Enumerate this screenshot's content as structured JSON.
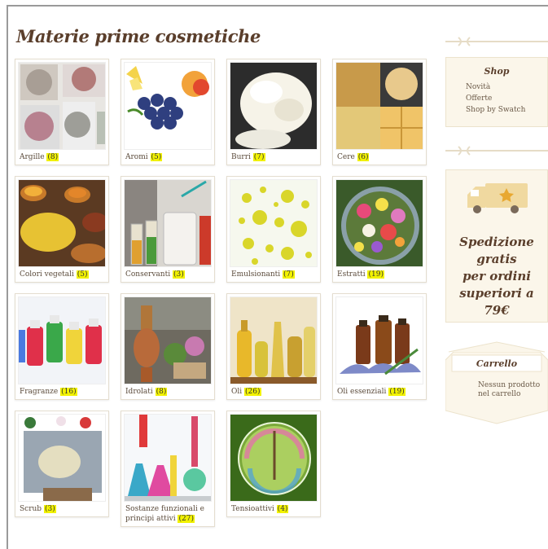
{
  "page": {
    "title": "Materie prime cosmetiche"
  },
  "categories": [
    {
      "name": "Argille",
      "count": "8"
    },
    {
      "name": "Aromi",
      "count": "5"
    },
    {
      "name": "Burri",
      "count": "7"
    },
    {
      "name": "Cere",
      "count": "6"
    },
    {
      "name": "Colori vegetali",
      "count": "5"
    },
    {
      "name": "Conservanti",
      "count": "3"
    },
    {
      "name": "Emulsionanti",
      "count": "7"
    },
    {
      "name": "Estratti",
      "count": "19"
    },
    {
      "name": "Fragranze",
      "count": "16"
    },
    {
      "name": "Idrolati",
      "count": "8"
    },
    {
      "name": "Oli",
      "count": "26"
    },
    {
      "name": "Oli essenziali",
      "count": "19"
    },
    {
      "name": "Scrub",
      "count": "3"
    },
    {
      "name": "Sostanze funzionali e principi attivi",
      "count": "27"
    },
    {
      "name": "Tensioattivi",
      "count": "4"
    }
  ],
  "sidebar": {
    "shop": {
      "title": "Shop",
      "items": [
        "Novità",
        "Offerte",
        "Shop by Swatch"
      ]
    },
    "shipping": {
      "line1": "Spedizione",
      "line2": "gratis",
      "line3": "per ordini",
      "line4": "superiori a 79€"
    },
    "cart": {
      "title": "Carrello",
      "line1": "Nessun prodotto",
      "line2": "nel carrello"
    }
  },
  "colors": {
    "title": "#5a3e2b",
    "count_highlight": "#f2f200",
    "sidebar_bg": "#fbf6ea",
    "truck": "#f0d9a0"
  }
}
